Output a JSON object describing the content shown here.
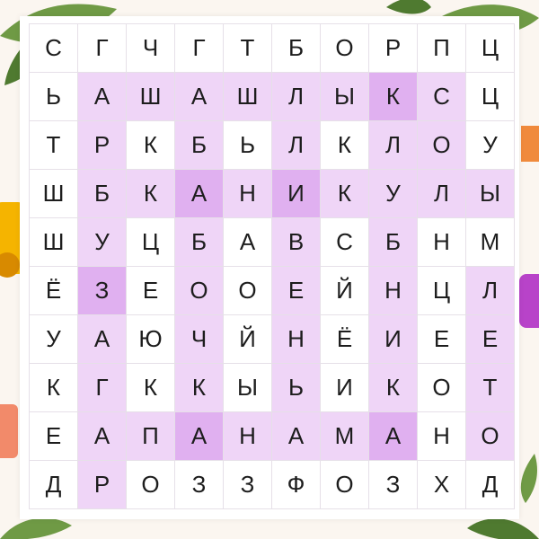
{
  "grid": [
    [
      "С",
      "Г",
      "Ч",
      "Г",
      "Т",
      "Б",
      "О",
      "Р",
      "П",
      "Ц"
    ],
    [
      "Ь",
      "А",
      "Ш",
      "А",
      "Ш",
      "Л",
      "Ы",
      "К",
      "С",
      "Ц"
    ],
    [
      "Т",
      "Р",
      "К",
      "Б",
      "Ь",
      "Л",
      "К",
      "Л",
      "О",
      "У"
    ],
    [
      "Ш",
      "Б",
      "К",
      "А",
      "Н",
      "И",
      "К",
      "У",
      "Л",
      "Ы"
    ],
    [
      "Ш",
      "У",
      "Ц",
      "Б",
      "А",
      "В",
      "С",
      "Б",
      "Н",
      "М"
    ],
    [
      "Ё",
      "З",
      "Е",
      "О",
      "О",
      "Е",
      "Й",
      "Н",
      "Ц",
      "Л"
    ],
    [
      "У",
      "А",
      "Ю",
      "Ч",
      "Й",
      "Н",
      "Ё",
      "И",
      "Е",
      "Е"
    ],
    [
      "К",
      "Г",
      "К",
      "К",
      "Ы",
      "Ь",
      "И",
      "К",
      "О",
      "Т"
    ],
    [
      "Е",
      "А",
      "П",
      "А",
      "Н",
      "А",
      "М",
      "А",
      "Н",
      "О"
    ],
    [
      "Д",
      "Р",
      "О",
      "З",
      "З",
      "Ф",
      "О",
      "З",
      "Х",
      "Д"
    ]
  ],
  "highlight": [
    [
      0,
      0,
      0,
      0,
      0,
      0,
      0,
      0,
      0,
      0
    ],
    [
      0,
      1,
      1,
      1,
      1,
      1,
      1,
      2,
      1,
      0
    ],
    [
      0,
      1,
      0,
      1,
      0,
      1,
      0,
      1,
      1,
      0
    ],
    [
      0,
      1,
      1,
      2,
      1,
      2,
      1,
      1,
      1,
      1
    ],
    [
      0,
      1,
      0,
      1,
      0,
      1,
      0,
      1,
      0,
      0
    ],
    [
      0,
      2,
      0,
      1,
      0,
      1,
      0,
      1,
      0,
      1
    ],
    [
      0,
      1,
      0,
      1,
      0,
      1,
      0,
      1,
      0,
      1
    ],
    [
      0,
      1,
      0,
      1,
      0,
      1,
      0,
      1,
      0,
      1
    ],
    [
      0,
      1,
      1,
      2,
      1,
      1,
      1,
      2,
      0,
      1
    ],
    [
      0,
      1,
      0,
      0,
      0,
      0,
      0,
      0,
      0,
      0
    ]
  ],
  "colors": {
    "highlight_light": "#efd5f7",
    "highlight_dark": "#e0b0f0",
    "leaf": "#6f9a45",
    "leaf_dark": "#4f7a30"
  }
}
